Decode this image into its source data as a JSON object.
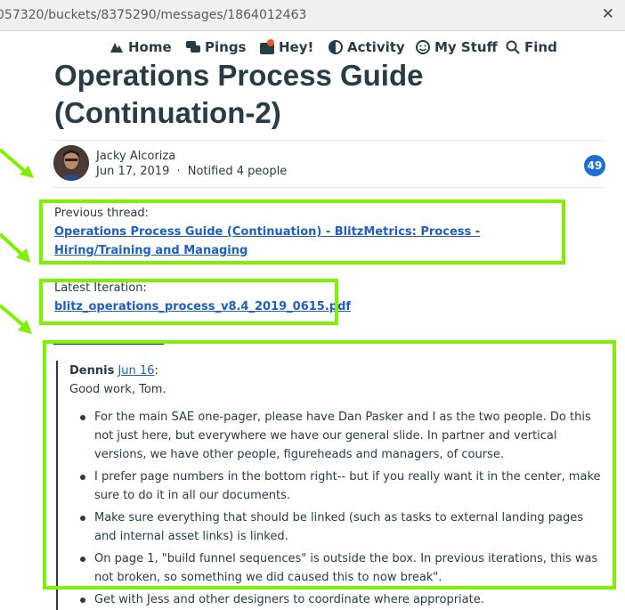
{
  "browser": {
    "url": "057320/buckets/8375290/messages/1864012463",
    "close": "✕"
  },
  "nav": {
    "home": "Home",
    "pings": "Pings",
    "hey": "Hey!",
    "activity": "Activity",
    "mystuff": "My Stuff",
    "find": "Find"
  },
  "post": {
    "title": "Operations Process Guide (Continuation-2)",
    "author": "Jacky Alcoriza",
    "date": "Jun 17, 2019",
    "notified": "Notified 4 people",
    "separator": "·",
    "badge": "49"
  },
  "content": {
    "prev_label": "Previous thread:",
    "prev_link": "Operations Process Guide (Continuation) - BlitzMetrics: Process - Hiring/Training and Managing",
    "latest_label": "Latest Iteration:",
    "latest_link": "blitz_operations_process_v8.4_2019_0615.pdf",
    "quote_author": "Dennis",
    "quote_date": "Jun 16",
    "quote_colon": ":",
    "quote_greeting": "Good work, Tom.",
    "bullets": [
      "For the main SAE one-pager, please have Dan Pasker and I as the two people.  Do this not just here, but everywhere we have our general slide. In partner and vertical versions, we have other people, figureheads and managers, of course.",
      "I prefer page numbers in the bottom right-- but if you really want it in the center, make sure to do it in all our documents.",
      "Make sure everything that should be linked (such as tasks to external landing pages and internal asset links) is linked.",
      "On page 1, \"build funnel sequences\" is outside the box.  In previous iterations, this was not broken, so something we did caused this to now break\".",
      "Get with Jess and other designers to coordinate where appropriate."
    ]
  },
  "colors": {
    "highlight": "#7ff000",
    "link": "#1f5fbf",
    "badge": "#1f6fd1",
    "text": "#283c46"
  }
}
